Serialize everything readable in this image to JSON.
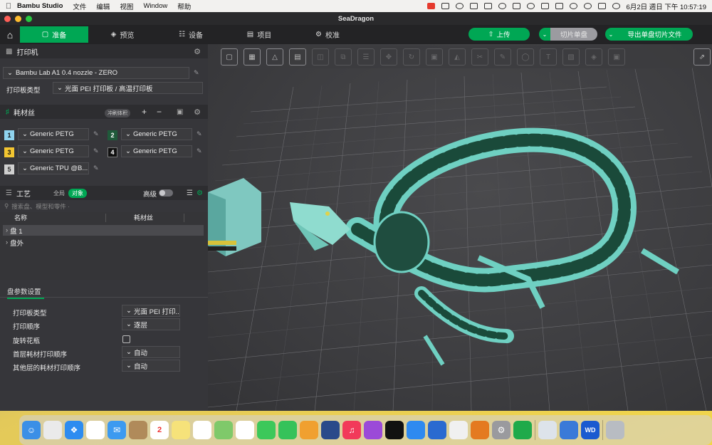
{
  "menubar": {
    "app": "Bambu Studio",
    "menus": [
      "文件",
      "编辑",
      "视图",
      "Window",
      "帮助"
    ],
    "clock": "6月2日 週日 下午 10:57:19"
  },
  "window": {
    "title": "SeaDragon"
  },
  "topbar": {
    "tabs": [
      {
        "label": "准备",
        "icon": "cube-icon"
      },
      {
        "label": "预览",
        "icon": "layers-icon"
      },
      {
        "label": "设备",
        "icon": "device-icon"
      },
      {
        "label": "项目",
        "icon": "project-icon"
      },
      {
        "label": "校准",
        "icon": "calibrate-icon"
      }
    ],
    "upload_label": "上传",
    "slice_label": "切片单盘",
    "export_label": "导出单盘切片文件"
  },
  "printer": {
    "section_title": "打印机",
    "printer_name": "Bambu Lab A1 0.4 nozzle - ZERO",
    "plate_type_label": "打印板类型",
    "plate_type_value": "光面 PEI 打印板 / 高温打印板"
  },
  "filament": {
    "section_title": "耗材丝",
    "flush_label": "冲刷体积",
    "slots": [
      {
        "num": "1",
        "name": "Generic PETG",
        "color": "#8fd3ee"
      },
      {
        "num": "2",
        "name": "Generic PETG",
        "color": "#1f5a3a"
      },
      {
        "num": "3",
        "name": "Generic PETG",
        "color": "#f2c531"
      },
      {
        "num": "4",
        "name": "Generic PETG",
        "color": "#111111"
      },
      {
        "num": "5",
        "name": "Generic TPU @B...",
        "color": "#cfcfcf"
      }
    ]
  },
  "process": {
    "section_title": "工艺",
    "global_label": "全局",
    "object_label": "对象",
    "advanced_label": "高级",
    "search_placeholder": "搜索盘、模型和零件 ·",
    "col_name": "名称",
    "col_filament": "耗材丝",
    "rows": [
      "盘 1",
      "盘外"
    ]
  },
  "plate_settings": {
    "tab_label": "盘参数设置",
    "items": [
      {
        "label": "打印板类型",
        "value": "光面 PEI 打印..."
      },
      {
        "label": "打印顺序",
        "value": "逐层"
      },
      {
        "label": "旋转花瓶",
        "value": ""
      },
      {
        "label": "首层耗材打印顺序",
        "value": "自动"
      },
      {
        "label": "其他层的耗材打印顺序",
        "value": "自动"
      }
    ]
  },
  "dock": {
    "calendar_day": "2"
  }
}
